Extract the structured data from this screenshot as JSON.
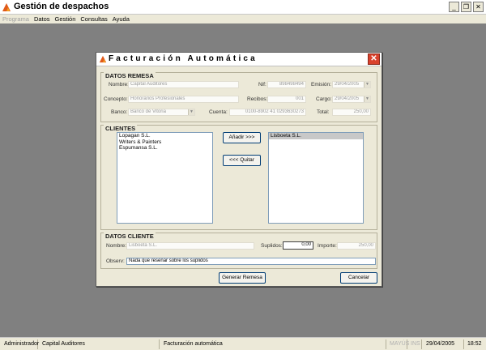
{
  "app": {
    "title": "Gestión de despachos",
    "window_buttons": [
      "_",
      "❐",
      "✕"
    ]
  },
  "menu": {
    "items": [
      {
        "label": "Programa",
        "disabled": true
      },
      {
        "label": "Datos",
        "disabled": false
      },
      {
        "label": "Gestión",
        "disabled": false
      },
      {
        "label": "Consultas",
        "disabled": false
      },
      {
        "label": "Ayuda",
        "disabled": false
      }
    ]
  },
  "dialog": {
    "title": "Facturación Automática",
    "close_label": "✕",
    "remesa": {
      "section_title": "DATOS REMESA",
      "nombre_label": "Nombre:",
      "nombre_value": "Capital Auditores",
      "nif_label": "Nif:",
      "nif_value": "898498494",
      "emision_label": "Emisión:",
      "emision_value": "29/04/2005",
      "concepto_label": "Concepto:",
      "concepto_value": "Honorarios Profesionales",
      "recibos_label": "Recibos:",
      "recibos_value": "001",
      "cargo_label": "Cargo:",
      "cargo_value": "29/04/2005",
      "banco_label": "Banco:",
      "banco_value": "Banco de Vitoria",
      "cuenta_label": "Cuenta:",
      "cuenta_value": "0100-8902 41 0293630273",
      "total_label": "Total:",
      "total_value": "250,00"
    },
    "clientes": {
      "section_title": "CLIENTES",
      "available": [
        "Lopagan S.L.",
        "Writers & Painters",
        "Espumansa S.L."
      ],
      "selected": [
        "Lisboeta S.L."
      ],
      "add_label": "Añadir >>>",
      "remove_label": "<<< Quitar"
    },
    "cliente": {
      "section_title": "DATOS CLIENTE",
      "nombre_label": "Nombre:",
      "nombre_value": "Lisboeta S.L.",
      "suplidos_label": "Suplidos:",
      "suplidos_value": "0,00",
      "importe_label": "Importe:",
      "importe_value": "250,00",
      "observ_label": "Observ:",
      "observ_value": "Nada que reseñar sobre los suplidos"
    },
    "generate_label": "Generar Remesa",
    "cancel_label": "Cancelar"
  },
  "statusbar": {
    "user": "Administrador",
    "company": "Capital Auditores",
    "module": "Facturación automática",
    "caps": "MAYÚS",
    "ins": "INS",
    "date": "29/04/2005",
    "time": "18:52"
  },
  "colors": {
    "close_button": "#d9412c",
    "logo": "#e05a1a"
  }
}
